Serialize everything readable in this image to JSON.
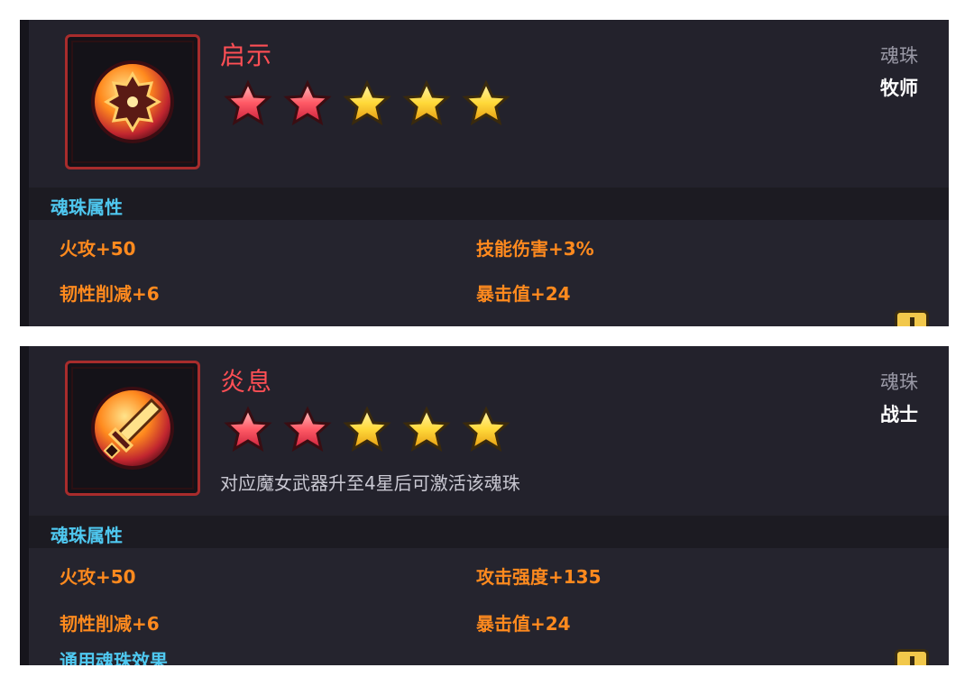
{
  "cards": [
    {
      "name": "启示",
      "type_label": "魂珠",
      "class_label": "牧师",
      "icon": "soul-orb-priest-icon",
      "stars": {
        "red": 2,
        "gold": 3
      },
      "section_title": "魂珠属性",
      "attributes": [
        "火攻+50",
        "技能伤害+3%",
        "韧性削减+6",
        "暴击值+24"
      ]
    },
    {
      "name": "炎息",
      "type_label": "魂珠",
      "class_label": "战士",
      "icon": "soul-orb-warrior-icon",
      "stars": {
        "red": 2,
        "gold": 3
      },
      "note": "对应魔女武器升至4星后可激活该魂珠",
      "section_title": "魂珠属性",
      "attributes": [
        "火攻+50",
        "攻击强度+135",
        "韧性削减+6",
        "暴击值+24"
      ],
      "next_section_partial": "通用魂珠效果"
    }
  ],
  "colors": {
    "panel_bg": "#23222c",
    "name_red": "#ff4f55",
    "section_blue": "#4fc8f0",
    "attr_orange": "#ff8a1e"
  }
}
